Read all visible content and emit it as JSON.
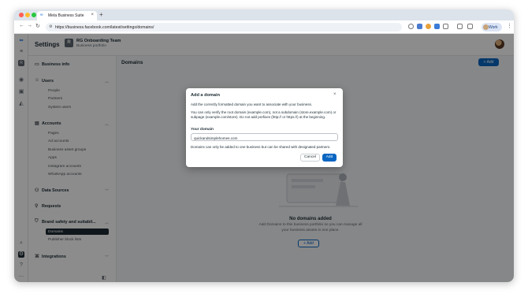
{
  "browser": {
    "tab_title": "Meta Business Suite",
    "tab_favicon": "meta-logo-icon",
    "url": "https://business.facebook.com/latest/settings/domains/",
    "profile_label": "Work",
    "colors": {
      "close": "#ff5f57",
      "minimize": "#febc2e",
      "maximize": "#28c840"
    }
  },
  "header": {
    "title": "Settings",
    "portfolio_initial": "R",
    "portfolio_name": "RG Onboarding Team",
    "portfolio_subtitle": "Business portfolio"
  },
  "sidebar": {
    "business_info": "Business info",
    "users": {
      "label": "Users",
      "items": [
        "People",
        "Partners",
        "System users"
      ]
    },
    "accounts": {
      "label": "Accounts",
      "items": [
        "Pages",
        "Ad accounts",
        "Business asset groups",
        "Apps",
        "Instagram accounts",
        "WhatsApp accounts"
      ]
    },
    "data_sources": "Data Sources",
    "requests": "Requests",
    "brand_safety": {
      "label": "Brand safety and suitabil...",
      "items": [
        "Domains",
        "Publisher block lists"
      ]
    },
    "integrations": "Integrations"
  },
  "content": {
    "title": "Domains",
    "add_label": "+ Add",
    "empty_title": "No domains added",
    "empty_desc": "Add Domains to this business portfolio so you can manage all your business assets in one place.",
    "empty_add_label": "+ Add"
  },
  "modal": {
    "title": "Add a domain",
    "intro": "Add the correctly formatted domain you want to associate with your business.",
    "verify_text": "You can only verify the root domain (example.com), not a subdomain (store.example.com) or subpage (example.com/store). Do not add prefixes (http:// or https://) at the beginning.",
    "field_label": "Your domain",
    "field_value": "quickandsimplehomes.com",
    "note": "Domains can only be added to one business but can be shared with designated partners.",
    "cancel_label": "Cancel",
    "add_label": "Add"
  },
  "theme": {
    "accent": "#0a66c2",
    "active_nav": "#1c2b33"
  }
}
